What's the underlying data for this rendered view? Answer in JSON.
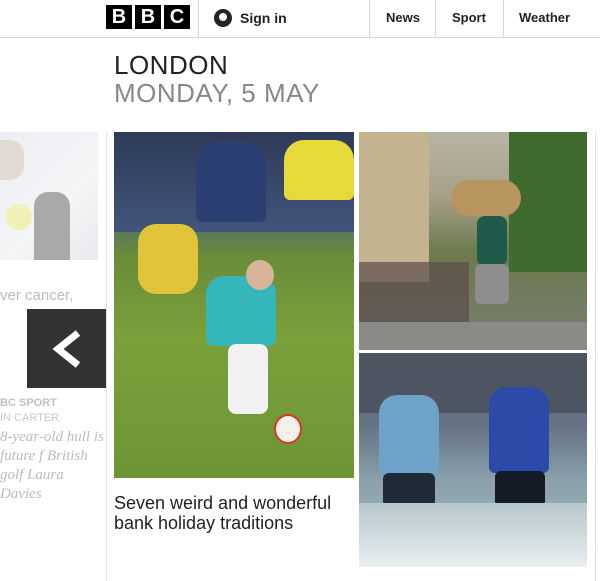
{
  "header": {
    "logo": [
      "B",
      "B",
      "C"
    ],
    "signin_label": "Sign in",
    "nav": [
      "News",
      "Sport",
      "Weather"
    ]
  },
  "location": {
    "city": "LONDON",
    "date": "MONDAY, 5 MAY"
  },
  "prev_card": {
    "snippet": "ver cancer,",
    "source": "BC SPORT",
    "author": "IN CARTER",
    "quote": "8-year-old hull is future f British golf Laura Davies"
  },
  "main_card": {
    "caption": "Seven weird and wonderful bank holiday traditions"
  },
  "icons": {
    "signin": "user-icon",
    "prev": "chevron-left-icon"
  },
  "colors": {
    "logo_bg": "#000000",
    "nav_text": "#222222",
    "date_text": "#888888",
    "prev_button_bg": "#333333"
  }
}
